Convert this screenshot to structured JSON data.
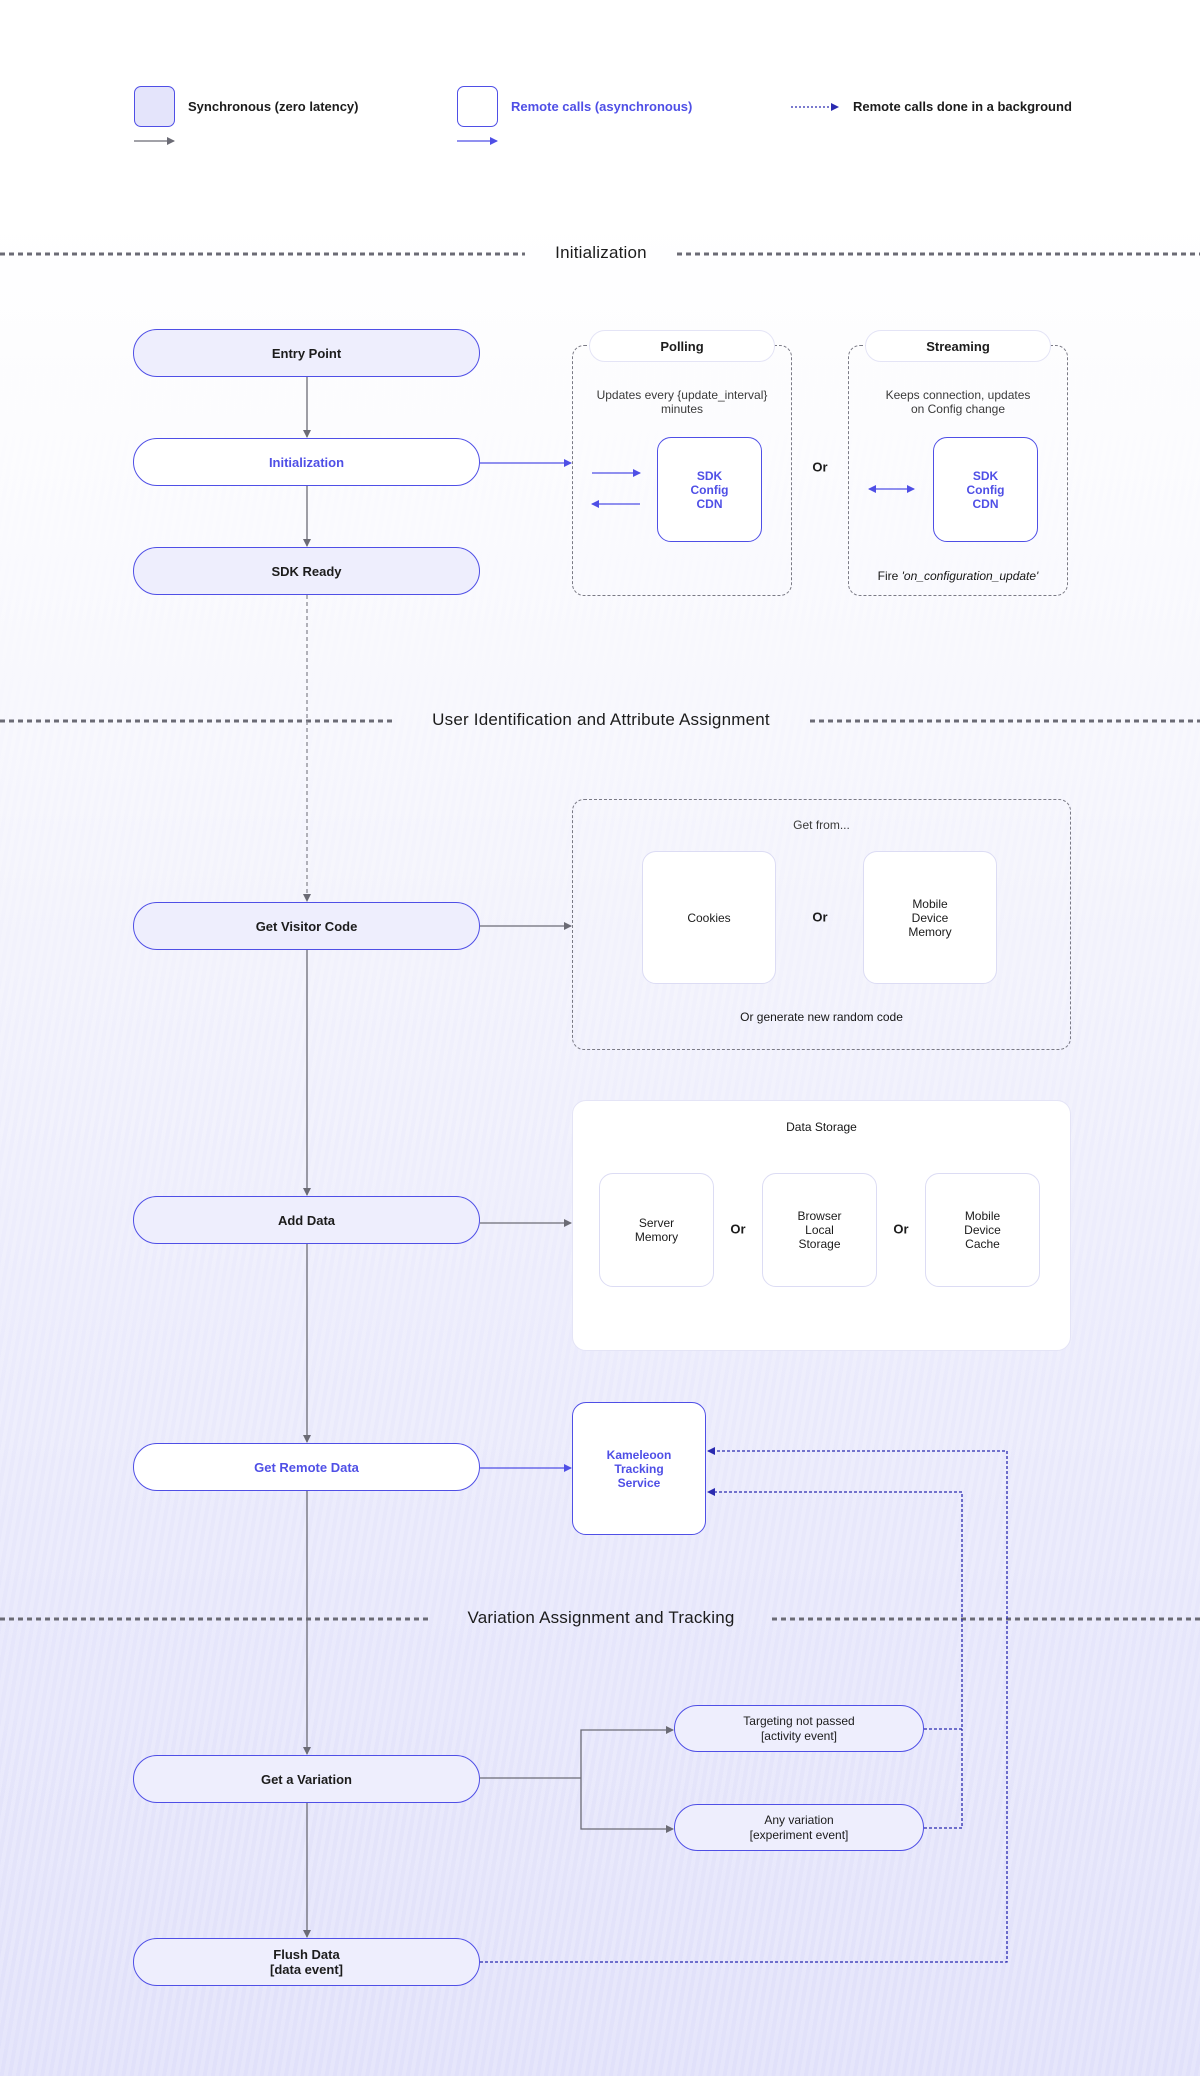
{
  "legend": {
    "sync_label": "Synchronous (zero latency)",
    "async_label": "Remote calls (asynchronous)",
    "background_label": "Remote calls done in a background"
  },
  "colors": {
    "accent": "#4f4fe6",
    "sync_fill": "#eeeefd",
    "gray_arrow": "#6b6b75",
    "dotted_arrow": "#2a2ab0"
  },
  "sections": {
    "initialization": "Initialization",
    "user_identification": "User Identification and Attribute Assignment",
    "variation": "Variation Assignment and Tracking"
  },
  "flow": {
    "entry_point": "Entry Point",
    "initialization": "Initialization",
    "sdk_ready": "SDK Ready",
    "get_visitor_code": "Get Visitor Code",
    "add_data": "Add Data",
    "get_remote_data": "Get Remote Data",
    "get_variation": "Get a Variation",
    "flush_data": "Flush Data\n[data event]"
  },
  "polling": {
    "title": "Polling",
    "description": "Updates every {update_interval}\nminutes",
    "target": "SDK\nConfig\nCDN"
  },
  "streaming": {
    "title": "Streaming",
    "description": "Keeps connection, updates\non Config change",
    "target": "SDK\nConfig\nCDN",
    "fire_prefix": "Fire ",
    "fire_event": "'on_configuration_update'"
  },
  "or_label": "Or",
  "visitor_code": {
    "title": "Get from...",
    "sources": [
      "Cookies",
      "Mobile\nDevice\nMemory"
    ],
    "fallback": "Or generate new random code"
  },
  "data_storage": {
    "title": "Data Storage",
    "options": [
      "Server\nMemory",
      "Browser\nLocal\nStorage",
      "Mobile\nDevice\nCache"
    ]
  },
  "tracking_service": "Kameleoon\nTracking\nService",
  "events": {
    "targeting": "Targeting not passed\n[activity event]",
    "any_variation": "Any variation\n[experiment event]"
  }
}
